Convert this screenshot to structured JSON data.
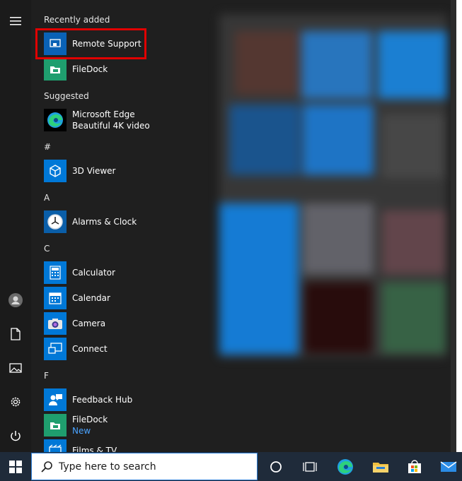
{
  "start_menu": {
    "sections": {
      "recently_added": "Recently added",
      "suggested": "Suggested",
      "hash": "#",
      "a": "A",
      "c": "C",
      "f": "F"
    },
    "apps": {
      "remote_support": "Remote Support",
      "filedock_recent": "FileDock",
      "edge_line1": "Microsoft Edge",
      "edge_line2": "Beautiful 4K video",
      "viewer_3d": "3D Viewer",
      "alarms": "Alarms & Clock",
      "calculator": "Calculator",
      "calendar": "Calendar",
      "camera": "Camera",
      "connect": "Connect",
      "feedback_hub": "Feedback Hub",
      "filedock_f": "FileDock",
      "filedock_new": "New",
      "films_tv": "Films & TV"
    },
    "rail_icons": [
      "hamburger-menu-icon",
      "user-icon",
      "document-icon",
      "pictures-icon",
      "settings-icon",
      "power-icon"
    ]
  },
  "taskbar": {
    "search_placeholder": "Type here to search",
    "icons": [
      "windows-start-icon",
      "search-icon",
      "cortana-icon",
      "task-view-icon",
      "edge-icon",
      "file-explorer-icon",
      "store-icon",
      "mail-icon"
    ]
  },
  "colors": {
    "accent": "#0078d7",
    "menu_bg": "#1f1f1f",
    "highlight": "#e00000",
    "taskbar_bg": "#1f2b3a"
  }
}
